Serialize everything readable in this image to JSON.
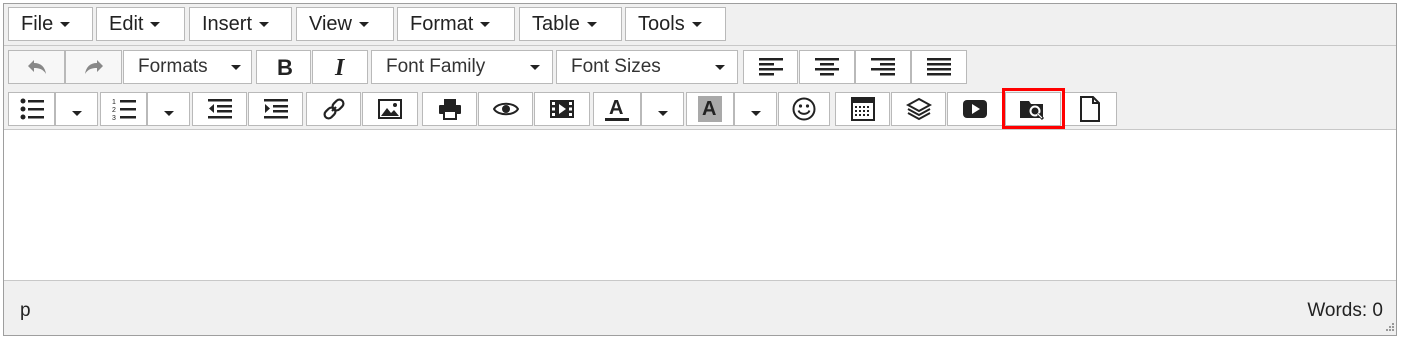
{
  "menubar": {
    "items": [
      {
        "label": "File"
      },
      {
        "label": "Edit"
      },
      {
        "label": "Insert"
      },
      {
        "label": "View"
      },
      {
        "label": "Format"
      },
      {
        "label": "Table"
      },
      {
        "label": "Tools"
      }
    ]
  },
  "toolbar": {
    "formats_label": "Formats",
    "font_family_label": "Font Family",
    "font_sizes_label": "Font Sizes"
  },
  "statusbar": {
    "path": "p",
    "word_count": "Words: 0"
  },
  "colors": {
    "highlight": "#ff0000",
    "border": "#b9b9b9",
    "chrome": "#f0f0f0"
  },
  "icons": [
    "undo-icon",
    "redo-icon",
    "bold-icon",
    "italic-icon",
    "align-left-icon",
    "align-center-icon",
    "align-right-icon",
    "align-justify-icon",
    "bullet-list-icon",
    "numbered-list-icon",
    "outdent-icon",
    "indent-icon",
    "link-icon",
    "image-icon",
    "print-icon",
    "preview-icon",
    "media-icon",
    "text-color-icon",
    "background-color-icon",
    "emoticons-icon",
    "table-icon",
    "layers-icon",
    "youtube-icon",
    "file-browser-icon",
    "new-document-icon"
  ]
}
